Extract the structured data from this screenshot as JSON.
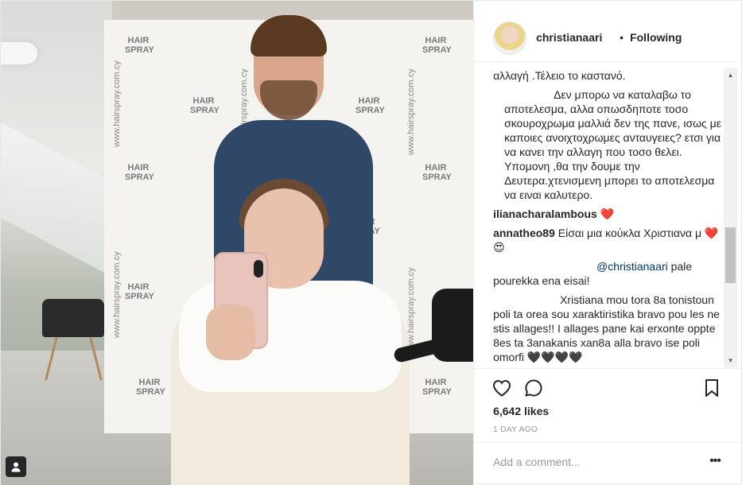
{
  "post": {
    "username": "christianaari",
    "separator": "•",
    "follow_status": "Following"
  },
  "photo": {
    "wall_text": "www.hairspray.com.cy",
    "logo_text": "HAIR SPRAY"
  },
  "comments": [
    {
      "user": "",
      "text": "αλλαγή .Τέλειο το καστανό."
    },
    {
      "user": "",
      "text": "Δεν μπορω να καταλαβω το αποτελεσμα, αλλα οπωσδηποτε τοσο σκουροχρωμα μαλλιά δεν της πανε, ισως με καποιες ανοιχτοχρωμες ανταυγειες? ετσι για να κανει την αλλαγη που τοσο θελει. Υπομονη ,θα την δουμε την Δευτερα.χτενισμενη μπορει το αποτελεσμα να ειναι καλυτερο."
    },
    {
      "user": "ilianacharalambous",
      "text": "❤️"
    },
    {
      "user": "annatheo89",
      "text": "Είσαι μια κούκλα Χριστιανα μ ❤️😍"
    },
    {
      "user": "",
      "mention": "@christianaari",
      "text": "pale pourekka ena eisai!"
    },
    {
      "user": "",
      "text": "Xristiana mou tora 8a tonistoun poli ta orea sou xaraktiristika bravo pou les ne stis allages!! I allages pane kai erxonte oppte 8es ta 3anakanis xan8a alla bravo ise poli omorfi 🖤🖤🖤🖤"
    }
  ],
  "actions": {
    "likes": "6,642 likes",
    "timestamp": "1 DAY AGO"
  },
  "comment_box": {
    "placeholder": "Add a comment...",
    "more": "•••"
  },
  "icons": [
    "heart-icon",
    "comment-icon",
    "bookmark-icon",
    "user-tag-icon"
  ]
}
